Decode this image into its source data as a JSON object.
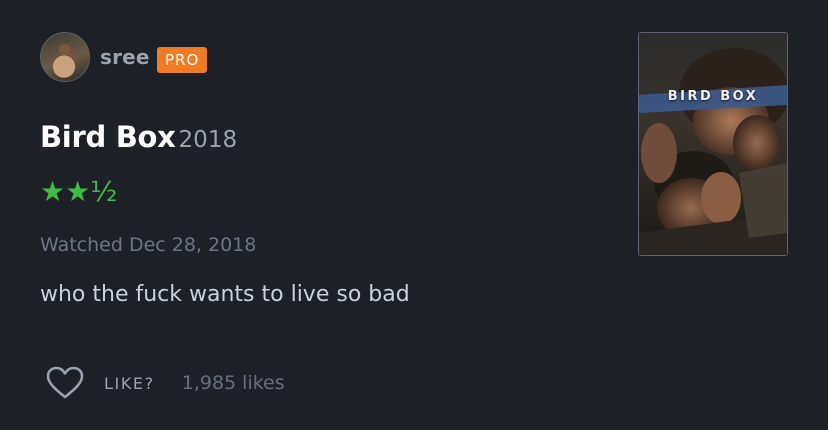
{
  "user": {
    "name": "sree",
    "badge": "PRO",
    "badge_color": "#f07b23"
  },
  "film": {
    "title": "Bird Box",
    "year": "2018",
    "poster_title": "BIRD BOX"
  },
  "rating": {
    "stars_text": "★★½",
    "value": 2.5,
    "max": 5,
    "color": "#40bc43"
  },
  "watched": "Watched Dec 28, 2018",
  "review_text": "who the fuck wants to live so bad",
  "likes": {
    "label": "LIKE?",
    "count_text": "1,985 likes"
  },
  "icons": {
    "like": "heart-outline-icon"
  }
}
